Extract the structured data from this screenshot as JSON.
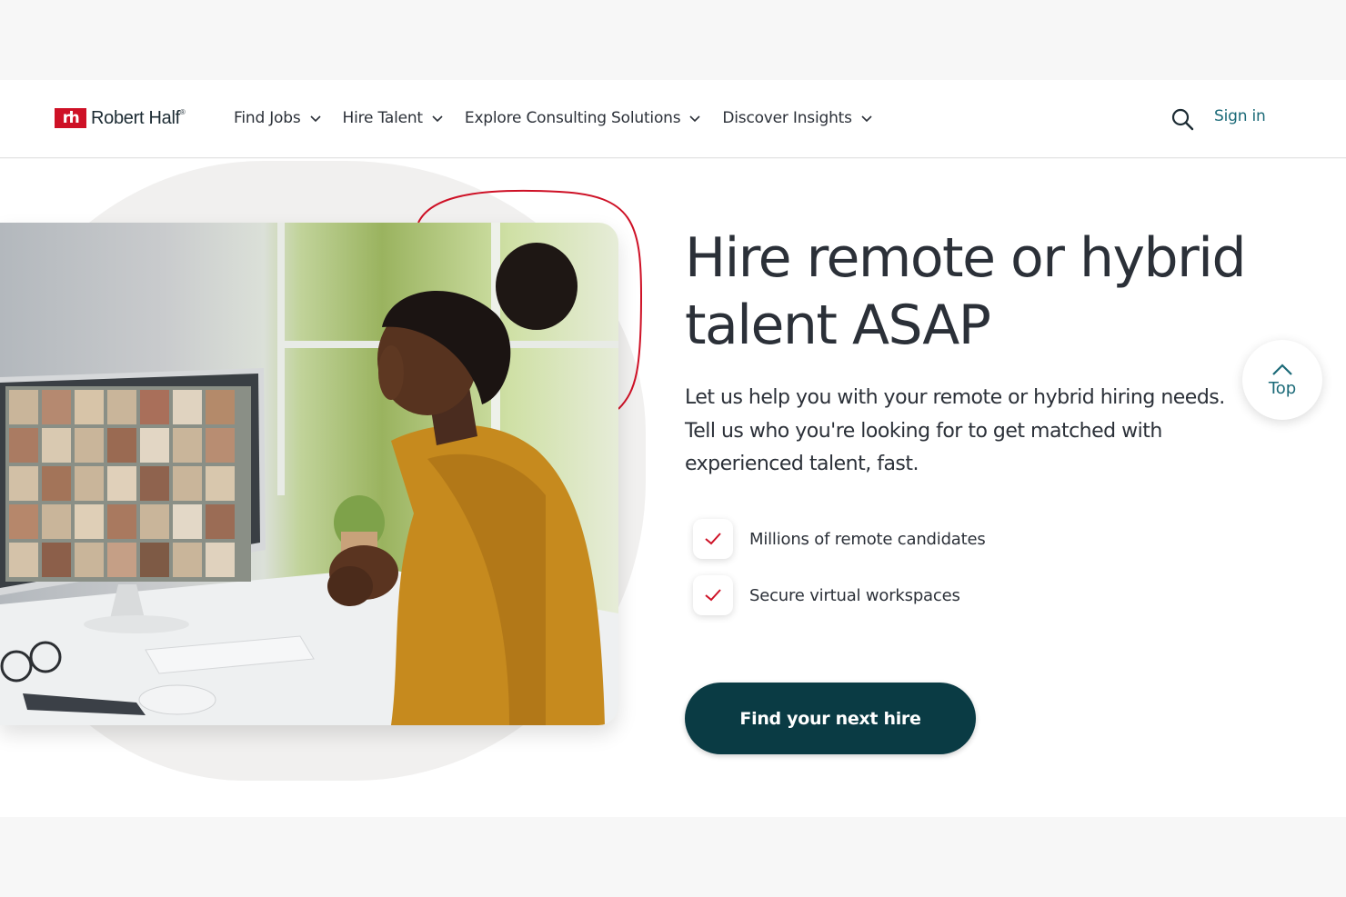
{
  "header": {
    "logo_text": "Robert Half",
    "logo_mark": "rh",
    "logo_trademark": "®",
    "menu": [
      {
        "label": "Find Jobs"
      },
      {
        "label": "Hire Talent"
      },
      {
        "label": "Explore Consulting Solutions"
      },
      {
        "label": "Discover Insights"
      }
    ],
    "search_icon": "search-icon",
    "sign_in_label": "Sign in"
  },
  "hero": {
    "headline": "Hire remote or hybrid talent ASAP",
    "lead": "Let us help you with your remote or hybrid hiring needs. Tell us who you're looking for to get matched with experienced talent, fast.",
    "features": [
      {
        "icon": "check-icon",
        "label": "Millions of remote candidates"
      },
      {
        "icon": "check-icon",
        "label": "Secure virtual workspaces"
      }
    ],
    "cta_label": "Find your next hire"
  },
  "back_to_top": {
    "icon": "chevron-up-icon",
    "label": "Top"
  },
  "colors": {
    "brand_red": "#ce1126",
    "teal_link": "#1b6a78",
    "cta_dark_teal": "#0a3b44",
    "text": "#2b3038"
  }
}
